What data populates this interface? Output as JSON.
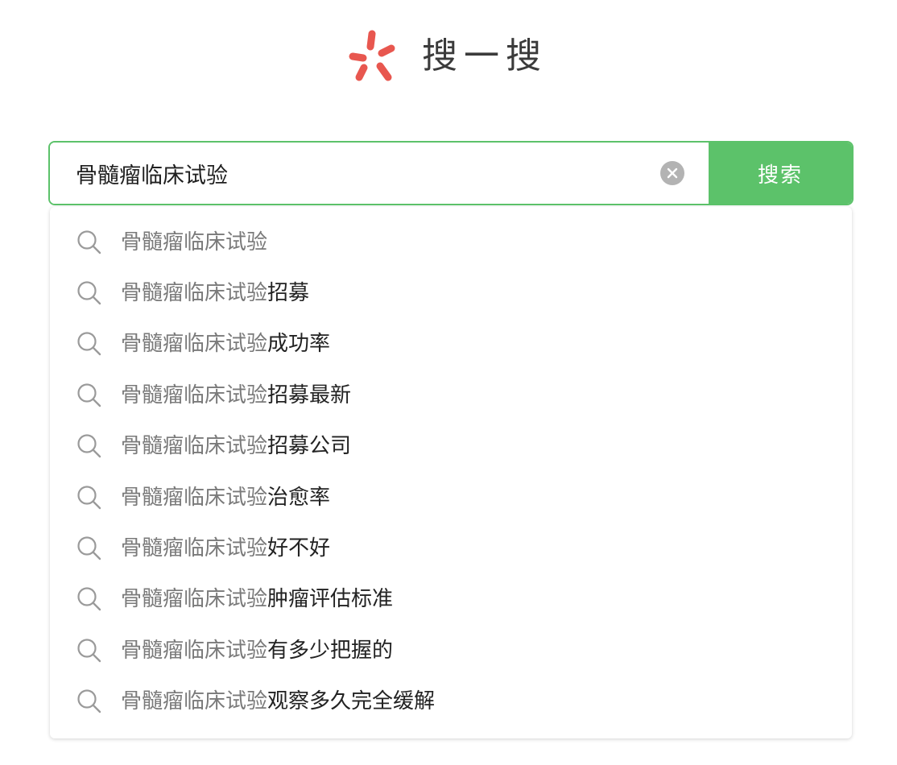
{
  "logo": {
    "icon": "asterisk-logo-icon",
    "text": "搜一搜",
    "color": "#e8574f"
  },
  "search": {
    "value": "骨髓瘤临床试验",
    "clear_icon": "close-circle-icon",
    "button_label": "搜索",
    "accent": "#5cc26a"
  },
  "suggestions": [
    {
      "prefix": "骨髓瘤临床试验",
      "suffix": ""
    },
    {
      "prefix": "骨髓瘤临床试验",
      "suffix": "招募"
    },
    {
      "prefix": "骨髓瘤临床试验",
      "suffix": "成功率"
    },
    {
      "prefix": "骨髓瘤临床试验",
      "suffix": "招募最新"
    },
    {
      "prefix": "骨髓瘤临床试验",
      "suffix": "招募公司"
    },
    {
      "prefix": "骨髓瘤临床试验",
      "suffix": "治愈率"
    },
    {
      "prefix": "骨髓瘤临床试验",
      "suffix": "好不好"
    },
    {
      "prefix": "骨髓瘤临床试验",
      "suffix": "肿瘤评估标准"
    },
    {
      "prefix": "骨髓瘤临床试验",
      "suffix": "有多少把握的"
    },
    {
      "prefix": "骨髓瘤临床试验",
      "suffix": "观察多久完全缓解"
    }
  ],
  "suggestion_icon": "search-icon"
}
